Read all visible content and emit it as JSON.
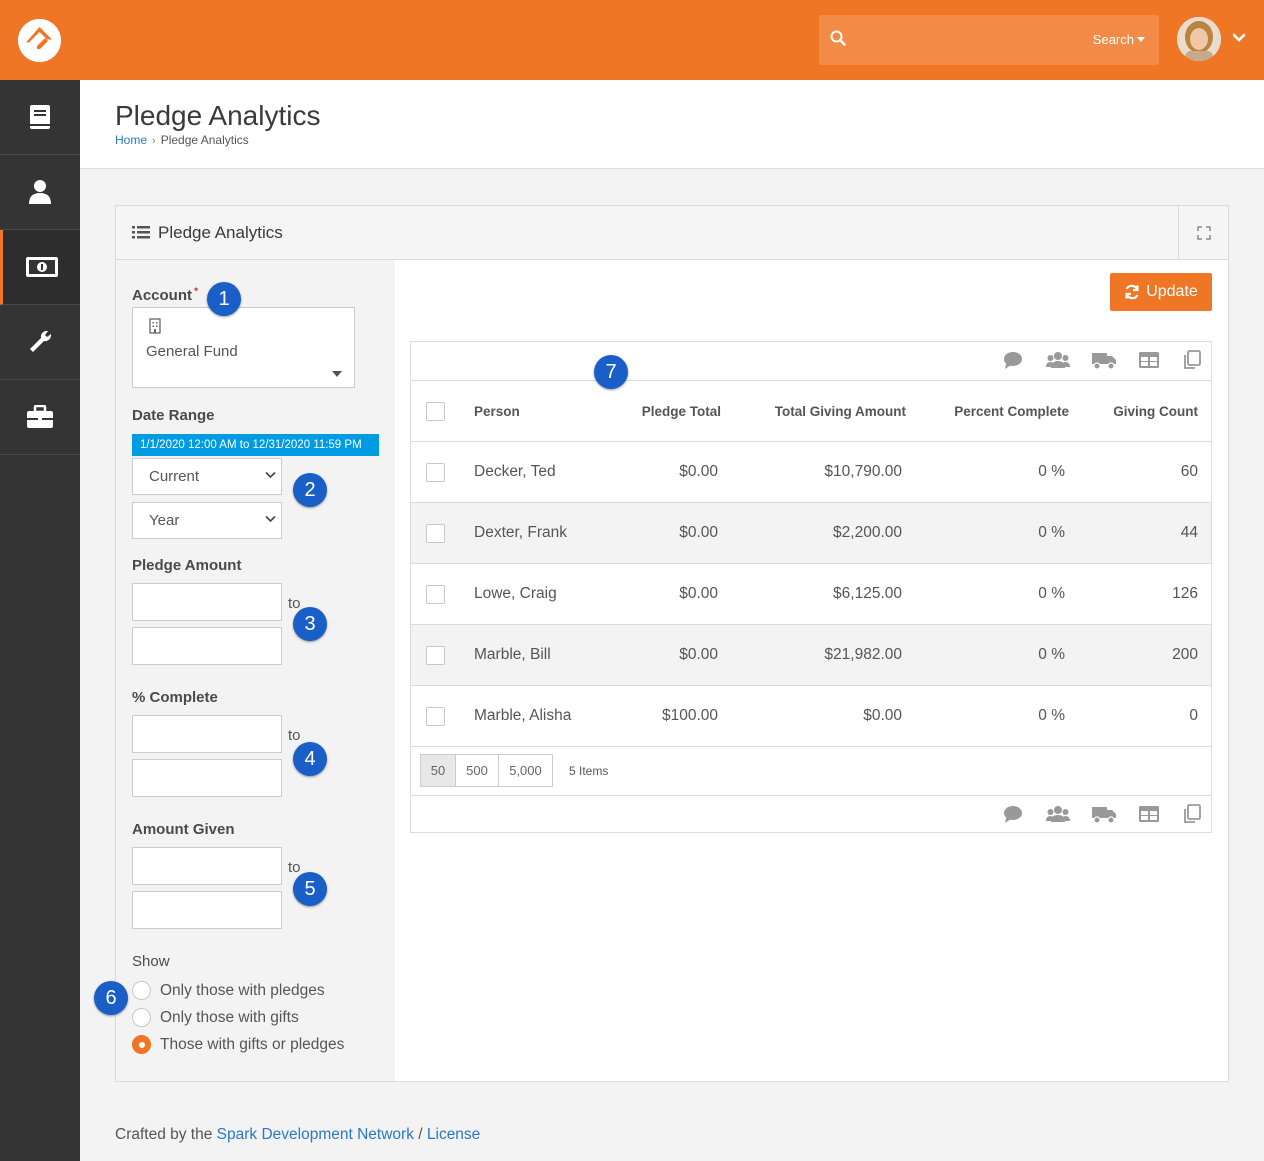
{
  "topbar": {
    "search_placeholder": "",
    "search_button": "Search"
  },
  "header": {
    "title": "Pledge Analytics",
    "breadcrumb": {
      "home": "Home",
      "current": "Pledge Analytics"
    }
  },
  "panel": {
    "title": "Pledge Analytics",
    "update_button": "Update"
  },
  "filters": {
    "account_label": "Account",
    "account_required": "•",
    "account_value": "General Fund",
    "date_range_label": "Date Range",
    "date_range_badge": "1/1/2020 12:00 AM to 12/31/2020 11:59 PM",
    "date_range_mode": "Current",
    "date_range_unit": "Year",
    "pledge_amount_label": "Pledge Amount",
    "percent_complete_label": "% Complete",
    "amount_given_label": "Amount Given",
    "to": "to",
    "show_label": "Show",
    "show_options": [
      "Only those with pledges",
      "Only those with gifts",
      "Those with gifts or pledges"
    ],
    "show_selected": 2
  },
  "grid": {
    "columns": [
      "Person",
      "Pledge Total",
      "Total Giving Amount",
      "Percent Complete",
      "Giving Count"
    ],
    "rows": [
      [
        "Decker, Ted",
        "$0.00",
        "$10,790.00",
        "0 %",
        "60"
      ],
      [
        "Dexter, Frank",
        "$0.00",
        "$2,200.00",
        "0 %",
        "44"
      ],
      [
        "Lowe, Craig",
        "$0.00",
        "$6,125.00",
        "0 %",
        "126"
      ],
      [
        "Marble, Bill",
        "$0.00",
        "$21,982.00",
        "0 %",
        "200"
      ],
      [
        "Marble, Alisha",
        "$100.00",
        "$0.00",
        "0 %",
        "0"
      ]
    ],
    "page_sizes": [
      "50",
      "500",
      "5,000"
    ],
    "items_count": "5 Items"
  },
  "markers": [
    "1",
    "2",
    "3",
    "4",
    "5",
    "6",
    "7"
  ],
  "footer": {
    "prefix": "Crafted by the ",
    "link": "Spark Development Network",
    "sep": " / ",
    "license": "License"
  },
  "colors": {
    "brand": "#ee7624",
    "sidebar": "#343434",
    "marker": "#1a5fc8",
    "date_badge": "#009ce3",
    "link": "#2a78c6"
  }
}
